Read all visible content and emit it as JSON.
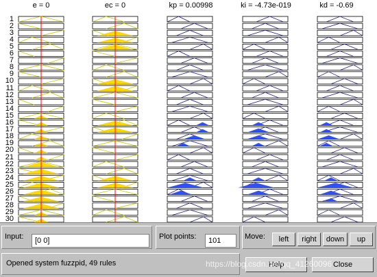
{
  "columns": [
    {
      "title": "e = 0",
      "kind": "input"
    },
    {
      "title": "ec = 0",
      "kind": "input"
    },
    {
      "title": "kp = 0.00998",
      "kind": "output"
    },
    {
      "title": "ki = -4.73e-019",
      "kind": "output"
    },
    {
      "title": "kd = -0.69",
      "kind": "output"
    }
  ],
  "rule_numbers": [
    "1",
    "2",
    "3",
    "4",
    "5",
    "6",
    "7",
    "8",
    "9",
    "10",
    "11",
    "12",
    "13",
    "14",
    "15",
    "16",
    "17",
    "18",
    "19",
    "20",
    "21",
    "22",
    "23",
    "24",
    "25",
    "26",
    "27",
    "28",
    "29",
    "30"
  ],
  "input": {
    "label": "Input:",
    "value": "[0 0]"
  },
  "plot_points": {
    "label": "Plot points:",
    "value": "101"
  },
  "move": {
    "label": "Move:",
    "buttons": [
      "left",
      "right",
      "down",
      "up"
    ]
  },
  "status": {
    "text": "Opened system fuzzpid, 49 rules"
  },
  "buttons": {
    "help": "Help",
    "close": "Close"
  },
  "watermark": "https://blog.csdn.net/qq_41260096",
  "colors": {
    "input_fill": "#ffd800",
    "input_line": "#c8c800",
    "output_fill": "#3050ff",
    "output_line": "#202080",
    "marker": "#ff0000",
    "panel": "#c0c0c0"
  },
  "input_markers": [
    0.5,
    0.5
  ],
  "fired": {
    "e": [
      [
        0,
        0
      ],
      [
        0,
        0
      ],
      [
        0,
        0
      ],
      [
        0,
        0
      ],
      [
        0,
        0
      ],
      [
        0,
        0
      ],
      [
        0,
        0
      ],
      [
        0,
        0
      ],
      [
        0,
        0
      ],
      [
        0,
        0
      ],
      [
        0,
        0
      ],
      [
        0,
        0
      ],
      [
        0,
        0
      ],
      [
        0,
        0
      ],
      [
        0.5,
        0.3
      ],
      [
        0.5,
        0.3
      ],
      [
        0.5,
        0.3
      ],
      [
        0.5,
        0.3
      ],
      [
        0.5,
        0.3
      ],
      [
        0.5,
        0.3
      ],
      [
        0.5,
        0.3
      ],
      [
        0.5,
        0.8
      ],
      [
        0.5,
        0.8
      ],
      [
        0.5,
        0.8
      ],
      [
        0.5,
        0.8
      ],
      [
        0.5,
        0.8
      ],
      [
        0.5,
        0.8
      ],
      [
        0.5,
        0.8
      ],
      [
        0.5,
        0.3
      ],
      [
        0.5,
        0.3
      ]
    ],
    "ec": [
      [
        0,
        0
      ],
      [
        0,
        0
      ],
      [
        0.5,
        0.8
      ],
      [
        0.5,
        0.8
      ],
      [
        0.5,
        0.8
      ],
      [
        0,
        0
      ],
      [
        0,
        0
      ],
      [
        0,
        0
      ],
      [
        0,
        0
      ],
      [
        0.5,
        0.8
      ],
      [
        0.5,
        0.8
      ],
      [
        0,
        0
      ],
      [
        0,
        0
      ],
      [
        0,
        0
      ],
      [
        0,
        0
      ],
      [
        0.5,
        0.8
      ],
      [
        0.5,
        0.8
      ],
      [
        0,
        0
      ],
      [
        0,
        0
      ],
      [
        0,
        0
      ],
      [
        0,
        0
      ],
      [
        0,
        0
      ],
      [
        0,
        0
      ],
      [
        0.5,
        0.8
      ],
      [
        0.5,
        0.8
      ],
      [
        0,
        0
      ],
      [
        0,
        0
      ],
      [
        0,
        0
      ],
      [
        0,
        0
      ],
      [
        0,
        0
      ]
    ],
    "kp": [
      [
        0,
        0
      ],
      [
        0,
        0
      ],
      [
        0,
        0
      ],
      [
        0,
        0
      ],
      [
        0,
        0
      ],
      [
        0,
        0
      ],
      [
        0,
        0
      ],
      [
        0,
        0
      ],
      [
        0,
        0
      ],
      [
        0,
        0
      ],
      [
        0,
        0
      ],
      [
        0,
        0
      ],
      [
        0,
        0
      ],
      [
        0,
        0
      ],
      [
        0,
        0
      ],
      [
        0.78,
        0.3
      ],
      [
        0.78,
        0.3
      ],
      [
        0.6,
        0.5
      ],
      [
        0.35,
        0.3
      ],
      [
        0,
        0
      ],
      [
        0,
        0
      ],
      [
        0,
        0
      ],
      [
        0,
        0
      ],
      [
        0.5,
        0.3
      ],
      [
        0.4,
        0.8
      ],
      [
        0.3,
        0.5
      ],
      [
        0,
        0
      ],
      [
        0,
        0
      ],
      [
        0,
        0
      ],
      [
        0,
        0
      ]
    ],
    "ki": [
      [
        0,
        0
      ],
      [
        0,
        0
      ],
      [
        0,
        0
      ],
      [
        0,
        0
      ],
      [
        0,
        0
      ],
      [
        0,
        0
      ],
      [
        0,
        0
      ],
      [
        0,
        0
      ],
      [
        0,
        0
      ],
      [
        0,
        0
      ],
      [
        0,
        0
      ],
      [
        0,
        0
      ],
      [
        0,
        0
      ],
      [
        0,
        0
      ],
      [
        0,
        0
      ],
      [
        0.35,
        0.3
      ],
      [
        0.35,
        0.5
      ],
      [
        0.35,
        0.5
      ],
      [
        0.35,
        0.3
      ],
      [
        0,
        0
      ],
      [
        0,
        0
      ],
      [
        0,
        0
      ],
      [
        0,
        0
      ],
      [
        0.35,
        0.3
      ],
      [
        0.3,
        0.8
      ],
      [
        0.35,
        0.5
      ],
      [
        0,
        0
      ],
      [
        0,
        0
      ],
      [
        0,
        0
      ],
      [
        0,
        0
      ]
    ],
    "kd": [
      [
        0,
        0
      ],
      [
        0,
        0
      ],
      [
        0,
        0
      ],
      [
        0,
        0
      ],
      [
        0,
        0
      ],
      [
        0,
        0
      ],
      [
        0,
        0
      ],
      [
        0,
        0
      ],
      [
        0,
        0
      ],
      [
        0,
        0
      ],
      [
        0,
        0
      ],
      [
        0,
        0
      ],
      [
        0,
        0
      ],
      [
        0,
        0
      ],
      [
        0,
        0
      ],
      [
        0.2,
        0.3
      ],
      [
        0.2,
        0.3
      ],
      [
        0.25,
        0.5
      ],
      [
        0.2,
        0.3
      ],
      [
        0,
        0
      ],
      [
        0,
        0
      ],
      [
        0,
        0
      ],
      [
        0,
        0
      ],
      [
        0.3,
        0.3
      ],
      [
        0.4,
        0.8
      ],
      [
        0.3,
        0.5
      ],
      [
        0.3,
        0.3
      ],
      [
        0,
        0
      ],
      [
        0,
        0
      ],
      [
        0,
        0
      ]
    ]
  }
}
